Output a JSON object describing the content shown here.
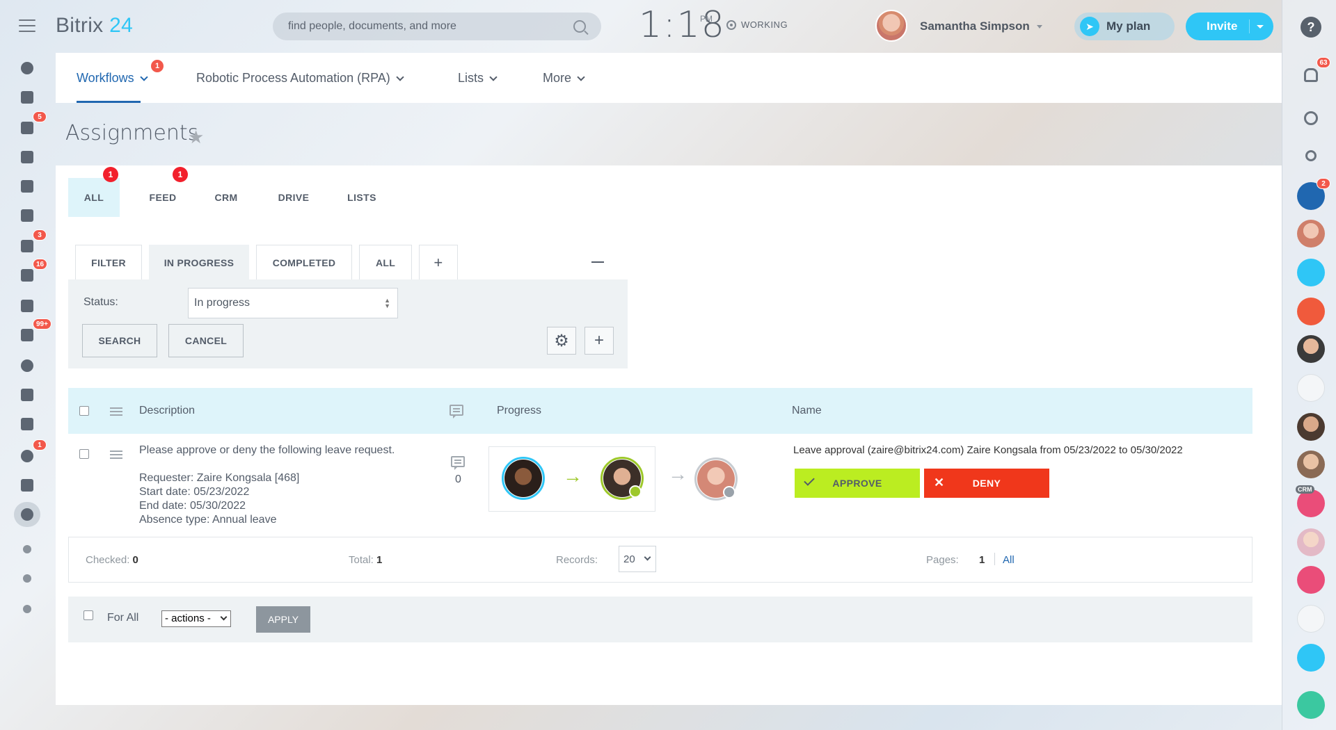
{
  "topbar": {
    "logo_text": "Bitrix",
    "logo_num": "24",
    "search_placeholder": "find people, documents, and more",
    "clock": "1:18",
    "ampm": "PM",
    "working_label": "WORKING",
    "user_name": "Samantha Simpson",
    "myplan_label": "My plan",
    "invite_label": "Invite"
  },
  "left_sidebar": {
    "items": [
      {
        "icon": "activity-stream-icon",
        "badge": ""
      },
      {
        "icon": "tasks-board-icon",
        "badge": ""
      },
      {
        "icon": "chat-icon",
        "badge": "5"
      },
      {
        "icon": "drive-icon",
        "badge": ""
      },
      {
        "icon": "documents-icon",
        "badge": ""
      },
      {
        "icon": "groups-icon",
        "badge": ""
      },
      {
        "icon": "calendar-icon",
        "badge": "3"
      },
      {
        "icon": "task-check-icon",
        "badge": "16"
      },
      {
        "icon": "contact-card-icon",
        "badge": ""
      },
      {
        "icon": "filter-funnel-icon",
        "badge": "99+"
      },
      {
        "icon": "target-icon",
        "badge": ""
      },
      {
        "icon": "mail-icon",
        "badge": ""
      },
      {
        "icon": "box-icon",
        "badge": ""
      },
      {
        "icon": "automation-icon",
        "badge": "1"
      },
      {
        "icon": "sliders-icon",
        "badge": ""
      },
      {
        "icon": "more-down-icon",
        "badge": ""
      },
      {
        "icon": "sitemap-icon",
        "badge": ""
      },
      {
        "icon": "settings-gear-icon",
        "badge": ""
      },
      {
        "icon": "add-plus-icon",
        "badge": ""
      }
    ]
  },
  "right_sidebar": {
    "notifications_badge": "63",
    "group_badge": "2",
    "crm_label": "CRM"
  },
  "nav": {
    "workflows": "Workflows",
    "workflows_badge": "1",
    "rpa": "Robotic Process Automation (RPA)",
    "lists": "Lists",
    "more": "More"
  },
  "page_title": "Assignments",
  "source_tabs": [
    {
      "label": "ALL",
      "badge": "1"
    },
    {
      "label": "FEED",
      "badge": "1"
    },
    {
      "label": "CRM",
      "badge": ""
    },
    {
      "label": "DRIVE",
      "badge": ""
    },
    {
      "label": "LISTS",
      "badge": ""
    }
  ],
  "filter_tabs": {
    "filter": "FILTER",
    "in_progress": "IN PROGRESS",
    "completed": "COMPLETED",
    "all": "ALL",
    "add": "+"
  },
  "filter": {
    "status_label": "Status:",
    "status_value": "In progress",
    "search_btn": "SEARCH",
    "cancel_btn": "CANCEL"
  },
  "grid": {
    "headers": {
      "description": "Description",
      "progress": "Progress",
      "name": "Name"
    },
    "row": {
      "description_line1": "Please approve or deny the following leave request.",
      "requester": "Requester: Zaire Kongsala [468]",
      "start_date": "Start date: 05/23/2022",
      "end_date": "End date: 05/30/2022",
      "absence_type": "Absence type: Annual leave",
      "comments": "0",
      "name": "Leave approval (zaire@bitrix24.com) Zaire Kongsala from 05/23/2022 to 05/30/2022",
      "approve": "APPROVE",
      "deny": "DENY"
    }
  },
  "footer": {
    "checked_label": "Checked:",
    "checked_value": "0",
    "total_label": "Total:",
    "total_value": "1",
    "records_label": "Records:",
    "records_value": "20",
    "pages_label": "Pages:",
    "pages_value": "1",
    "pages_all": "All"
  },
  "actions_bar": {
    "for_all": "For All",
    "actions_value": "- actions -",
    "apply": "APPLY"
  },
  "colors": {
    "accent": "#2fc6f6",
    "nav_active": "#2067b0",
    "approve": "#bbed21",
    "deny": "#f0371b",
    "badge": "#f2584b"
  }
}
